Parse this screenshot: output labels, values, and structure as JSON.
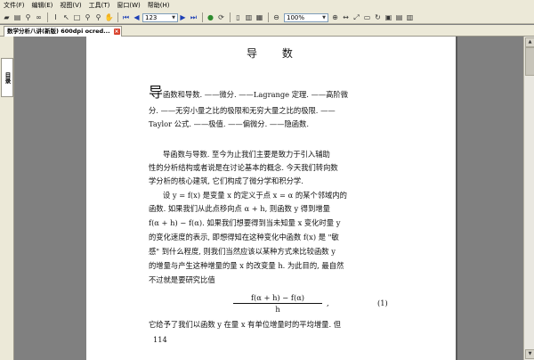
{
  "menu": [
    "文件(F)",
    "编辑(E)",
    "视图(V)",
    "工具(T)",
    "窗口(W)",
    "帮助(H)"
  ],
  "toolbar": {
    "page_number": "123",
    "zoom": "100%"
  },
  "document_tab": {
    "title": "数学分析八讲(新版) 600dpi ocred..."
  },
  "sidebar": {
    "tab_label": "目录"
  },
  "page": {
    "heading": "导   数",
    "intro": [
      "导函数和导数. ——微分. ——Lagrange 定理. ——高阶微",
      "分. ——无穷小量之比的极限和无穷大量之比的极限. ——",
      "Taylor 公式. ——极值. ——偏微分. ——隐函数."
    ],
    "body1": [
      "导函数与导数.    至今为止我们主要是致力于引入辅助",
      "性的分析结构或者说是在讨论基本的概念. 今天我们转向数",
      "学分析的核心建筑, 它们构成了微分学和积分学."
    ],
    "body2": [
      "设 y = f(x) 是变量 x 的定义于点 x = α 的某个邻域内的",
      "函数. 如果我们从此点移向点 α + h, 则函数 y 得到增量",
      "f(α + h) − f(α). 如果我们想要得到当未知量 x 变化时量 y",
      "的变化速度的表示, 即想得知在这种变化中函数 f(x) 是 \"敏",
      "感\" 到什么程度, 则我们当然应该以某种方式来比较函数 y",
      "的增量与产生这种增量的量 x 的改变量 h. 为此目的, 最自然",
      "不过就是要研究比值"
    ],
    "formula": {
      "numerator": "f(α + h) − f(α)",
      "denominator": "h",
      "suffix": ",",
      "number": "(1)"
    },
    "body3": "它给予了我们以函数 y 在量 x 有单位增量时的平均增量. 但",
    "page_number": "114"
  }
}
